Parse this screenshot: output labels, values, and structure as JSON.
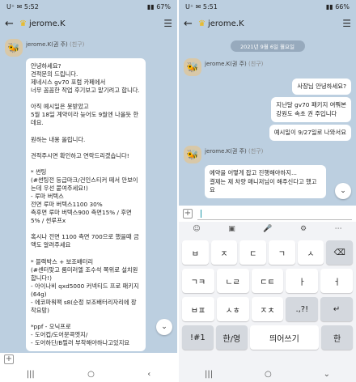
{
  "left": {
    "status": {
      "time": "5:52",
      "indicators": "U⁺ ✉",
      "signal": "▮▮ 67%"
    },
    "header": {
      "title": "jerome.K"
    },
    "sender": {
      "name": "jerome.K(권 주)",
      "role": "(친구)"
    },
    "message_text": "안녕하세요?\n견적문의 드립니다.\n제네시스 gv70 포럼 카페에서\n너무 꼼꼼한 작업 후기보고 맡기려고 합니다.\n\n아직 예시일은 못받았고\n5월 18일 계약이라 늦어도 9월엔 나올듯 한데요.\n\n원하는 내용 올립니다.\n\n견적주시면 확인하고 연락드리겠습니다!\n\n* 썬팅\n(#썬팅전 등급마크/건인스티커 떼서 안보이는데 우선 붙여주세요!)\n- 루마 버텍스\n전면 루마 버텍스1100 30%\n측후면 루마 버텍스900 측면15% / 후면5% / 썬루프x\n\n혹시나 전면 1100 측면 700으로 했을때 금액도 알려주세요\n\n* 블랙박스 + 보조배터리\n(#센터맞고 룸미러엘 조수석 쪽위로 설치원합니다!)\n- 아이나비 qxd5000 커넥티드 프로 패키지(64g)\n- 에코파워팩 s8(순정 보조배터리자리에 장착요망)\n\n*ppf - 오닉프로\n- 도어컵/도어문콕엣지/\n- 도어하단/B필러 부착해야하나고있지요"
  },
  "right": {
    "status": {
      "time": "5:51",
      "indicators": "U⁺ ✉",
      "signal": "▮▮ 66%"
    },
    "header": {
      "title": "jerome.K"
    },
    "date_label": "2021년 9월 6일 월요일",
    "sender": {
      "name": "jerome.K(권 주)",
      "role": "(친구)"
    },
    "out_messages": [
      "사장님 안녕하세요?",
      "지난달 gv70 패키지 여쭤본\n강원도 속초 권 주입니다",
      "예시일이 9/27일로 나와서요"
    ],
    "in_message": "예약을 어떻게 잡고 진행해야하지...\n결제는 제 차량 매니저님이 해주신다고 했고요",
    "keyboard": {
      "row1": [
        "ㅂ",
        "ㅈ",
        "ㄷ",
        "ㄱ",
        "ㅅ"
      ],
      "row2": [
        "ㄱㅋ",
        "ㄴㄹ",
        "ㄷㅌ",
        "ㅏ",
        "ㅓ"
      ],
      "row3": [
        "ㅂㅍ",
        "ㅅㅎ",
        "ㅈㅊ",
        ".,?!"
      ],
      "row4": [
        "!#1",
        "한/영",
        "띄어쓰기",
        "한"
      ]
    }
  }
}
